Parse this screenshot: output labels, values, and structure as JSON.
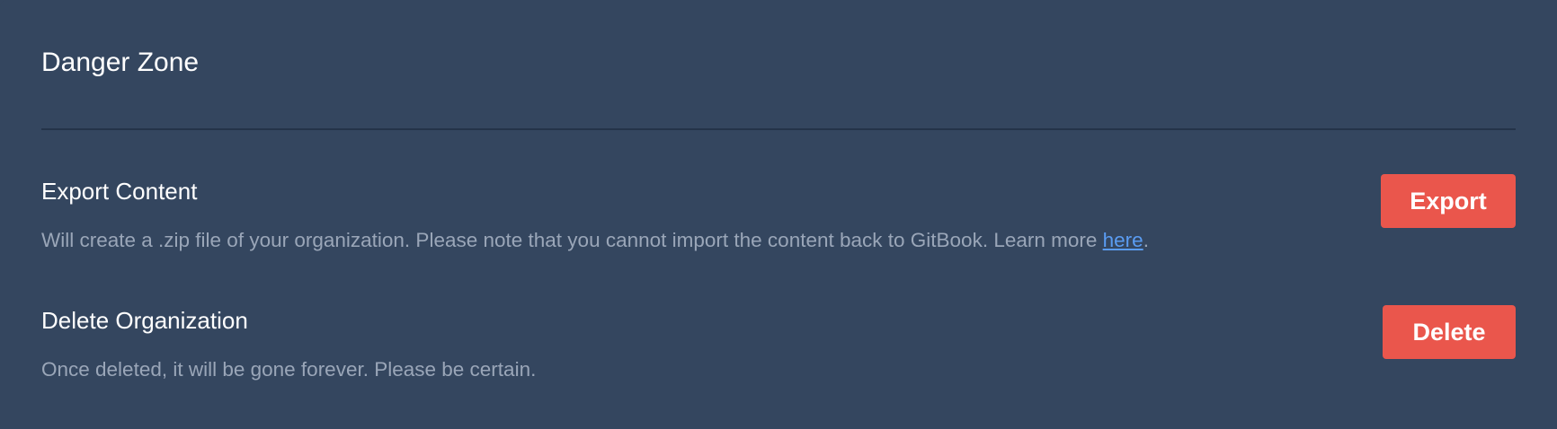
{
  "panel": {
    "title": "Danger Zone"
  },
  "export": {
    "title": "Export Content",
    "desc_before": "Will create a .zip file of your organization. Please note that you cannot import the content back to GitBook. Learn more ",
    "desc_link": "here",
    "desc_after": ".",
    "button_label": "Export"
  },
  "delete": {
    "title": "Delete Organization",
    "desc": "Once deleted, it will be gone forever. Please be certain.",
    "button_label": "Delete"
  },
  "colors": {
    "background": "#34465f",
    "danger": "#ea564c",
    "link": "#5a9cf2",
    "muted_text": "#9aa6b8"
  }
}
